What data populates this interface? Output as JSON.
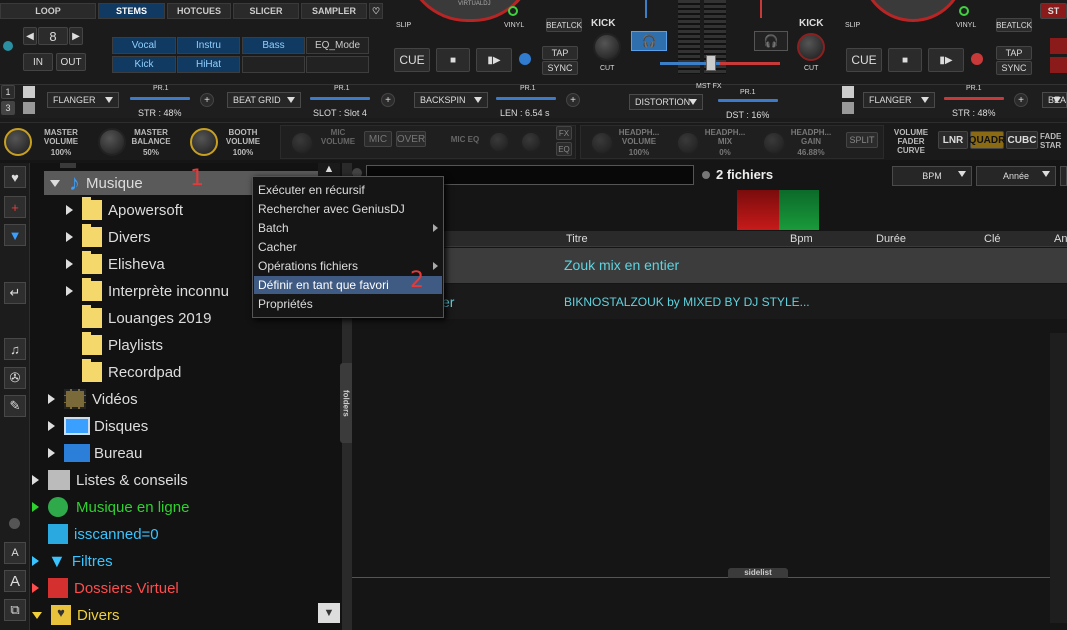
{
  "deck_left": {
    "tabs": [
      "LOOP",
      "STEMS",
      "HOTCUES",
      "SLICER",
      "SAMPLER"
    ],
    "loop_value": "8",
    "in_label": "IN",
    "out_label": "OUT",
    "stems": [
      "Vocal",
      "Instru",
      "Bass",
      "EQ_Mode",
      "Kick",
      "HiHat"
    ],
    "slip": "SLIP",
    "vinyl": "VINYL",
    "beatlock": "BEATLCK",
    "kick": "KICK",
    "cut": "CUT",
    "cue": "CUE",
    "tap": "TAP",
    "sync": "SYNC",
    "logo": "VIRTUALDJ"
  },
  "deck_right": {
    "slip": "SLIP",
    "vinyl": "VINYL",
    "beatlock": "BEATLCK",
    "kick": "KICK",
    "cut": "CUT",
    "cue": "CUE",
    "tap": "TAP",
    "sync": "SYNC",
    "st": "ST"
  },
  "fx": {
    "pr": "PR.1",
    "fx1": "FLANGER",
    "str1": "STR : 48%",
    "fx2": "BEAT GRID",
    "slot": "SLOT : Slot 4",
    "fx3": "BACKSPIN",
    "len": "LEN : 6.54 s",
    "mst": "MST FX",
    "fx4": "DISTORTION",
    "dst": "DST : 16%",
    "fx5": "FLANGER",
    "str2": "STR : 48%",
    "fx6": "BEA",
    "deck1": "1",
    "deck3": "3"
  },
  "mixer": {
    "master_volume": "MASTER VOLUME",
    "mv_val": "100%",
    "master_balance": "MASTER BALANCE",
    "mb_val": "50%",
    "booth_volume": "BOOTH VOLUME",
    "bv_val": "100%",
    "mic_volume": "MIC VOLUME",
    "mic": "MIC",
    "over": "OVER",
    "mic_eq": "MIC EQ",
    "fx": "FX",
    "eq": "EQ",
    "hp_volume": "HEADPH... VOLUME",
    "hpv_val": "100%",
    "hp_mix": "HEADPH... MIX",
    "hpm_val": "0%",
    "hp_gain": "HEADPH... GAIN",
    "hpg_val": "46.88%",
    "split": "SPLIT",
    "vfc": "VOLUME FADER CURVE",
    "lnr": "LNR",
    "quadr": "QUADR",
    "cubc": "CUBC",
    "fade": "FADE STAR"
  },
  "tree": {
    "musique": "Musique",
    "children": [
      "Apowersoft",
      "Divers",
      "Elisheva",
      "Interprète inconnu",
      "Louanges 2019",
      "Playlists",
      "Recordpad"
    ],
    "videos": "Vidéos",
    "disques": "Disques",
    "bureau": "Bureau",
    "listes": "Listes & conseils",
    "musique_en_ligne": "Musique en ligne",
    "isscanned": "isscanned=0",
    "filtres": "Filtres",
    "dossiers_virtuel": "Dossiers Virtuel",
    "divers": "Divers"
  },
  "browser": {
    "count": "2 fichiers",
    "bpm": "BPM",
    "annee": "Année",
    "cols": [
      "Titre",
      "Bpm",
      "Durée",
      "Clé",
      "An"
    ],
    "rows": [
      {
        "title": "Zouk mix en entier",
        "artist": ""
      },
      {
        "title": "BIKNOSTALZOUK by MIXED BY DJ STYLE...",
        "artist": "er"
      }
    ],
    "folders_tab": "folders",
    "sidelist_tab": "sidelist"
  },
  "context_menu": {
    "items": [
      "Exécuter en récursif",
      "Rechercher avec GeniusDJ",
      "Batch",
      "Cacher",
      "Opérations fichiers",
      "Définir en tant que favori",
      "Propriétés"
    ]
  },
  "annotations": {
    "one": "1",
    "two": "2"
  }
}
